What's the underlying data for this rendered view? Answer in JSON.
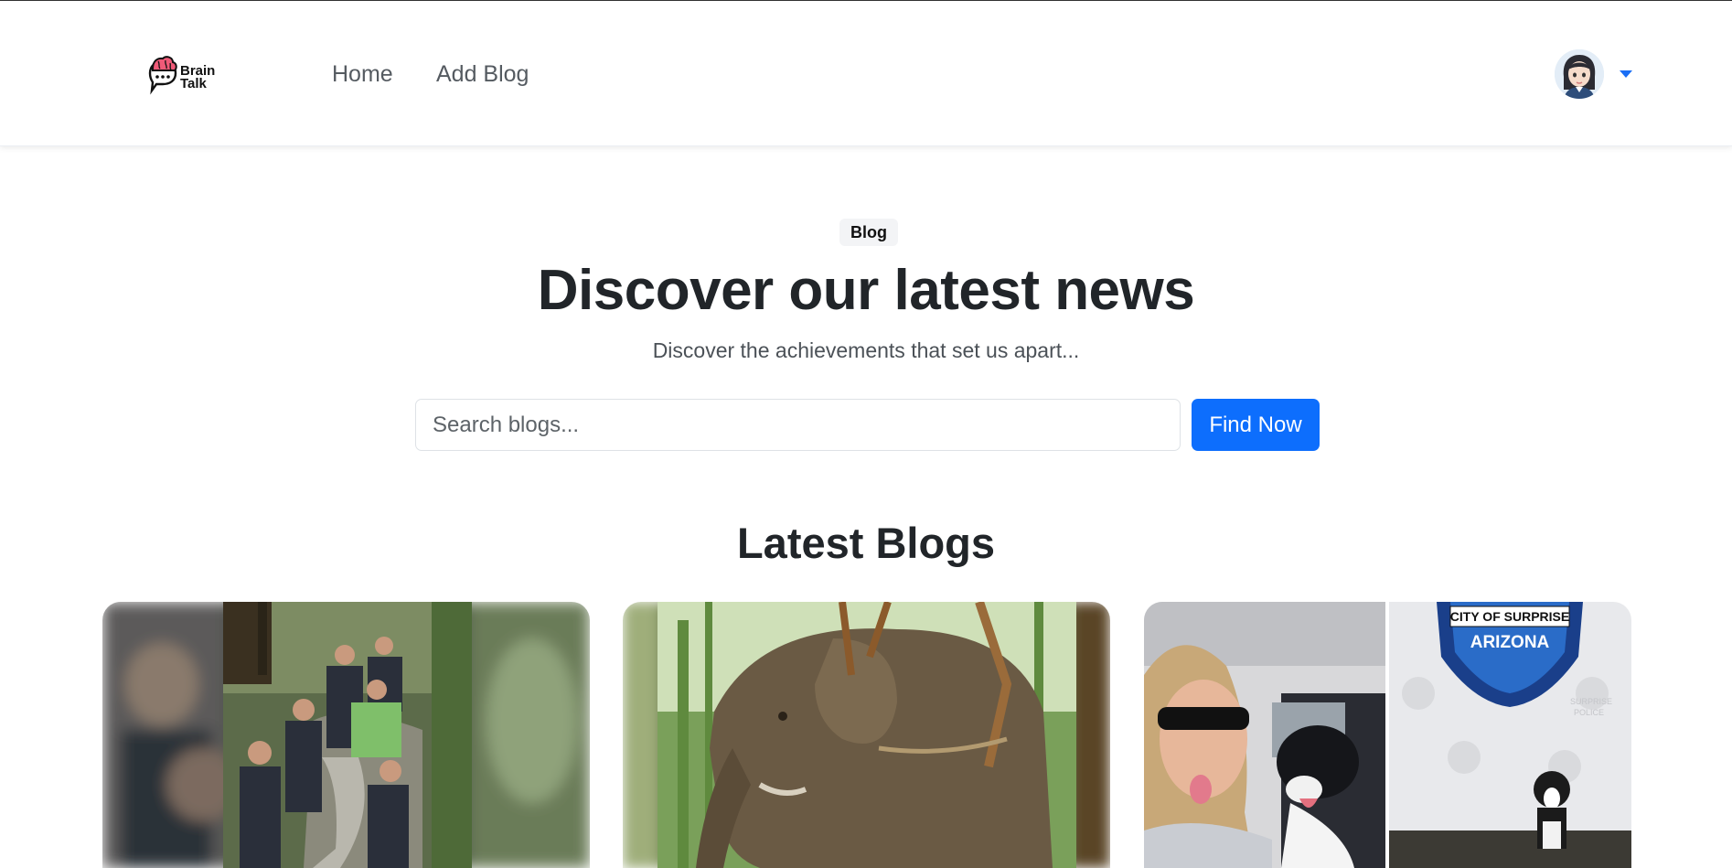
{
  "navbar": {
    "logo_text": "Brain Talk",
    "links": [
      {
        "label": "Home"
      },
      {
        "label": "Add Blog"
      }
    ],
    "avatar_icon": "user-avatar",
    "dropdown_icon": "caret-down-icon",
    "accent": "#1a6ef5"
  },
  "hero": {
    "badge": "Blog",
    "title": "Discover our latest news",
    "subtitle": "Discover the achievements that set us apart...",
    "search_placeholder": "Search blogs...",
    "search_value": "",
    "button_label": "Find Now",
    "button_color": "#0d6efd"
  },
  "latest": {
    "title": "Latest Blogs",
    "cards": [
      {
        "image": "rescue-team-carrying-animal-photo",
        "overlay_text": []
      },
      {
        "image": "elephant-photo",
        "overlay_text": []
      },
      {
        "image": "woman-with-dog-and-police-dog-photo",
        "overlay_text": [
          "CITY OF SURPRISE",
          "ARIZONA",
          "SURPRISE",
          "POLICE"
        ]
      }
    ]
  }
}
